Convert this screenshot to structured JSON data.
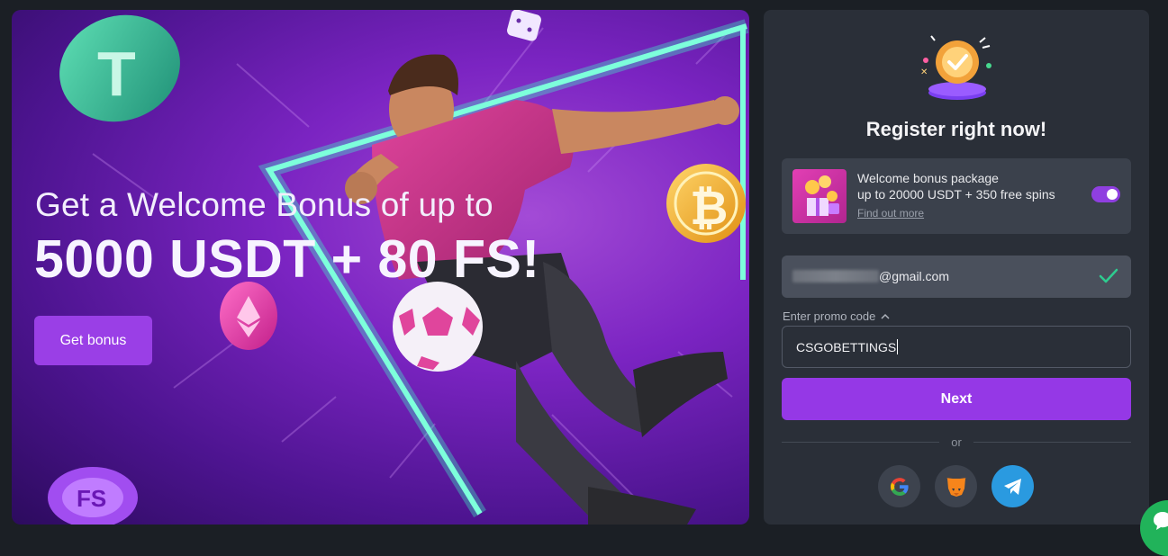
{
  "banner": {
    "line1": "Get a Welcome Bonus of up to",
    "line2": "5000 USDT + 80 FS!",
    "button": "Get bonus",
    "chip_label": "FS"
  },
  "register": {
    "title": "Register right now!",
    "bonus": {
      "title": "Welcome bonus package",
      "subtitle": "up to 20000 USDT + 350 free spins",
      "link": "Find out more",
      "enabled": true
    },
    "email": {
      "value": "@gmail.com",
      "valid": true
    },
    "promo": {
      "label": "Enter promo code",
      "value": "CSGOBETTINGS"
    },
    "next_label": "Next",
    "or_label": "or",
    "socials": [
      "google-icon",
      "metamask-icon",
      "telegram-icon"
    ]
  },
  "colors": {
    "accent": "#9538e6",
    "panel": "#2a2f38",
    "success": "#2ecc8f",
    "chat": "#21b35a"
  }
}
